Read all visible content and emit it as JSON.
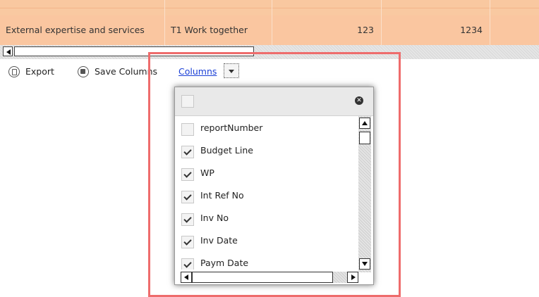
{
  "table": {
    "row": {
      "cost_category": "External expertise and services",
      "work_package": "T1 Work together",
      "value_1": "123",
      "value_2": "1234"
    },
    "row_color": "#fac6a0"
  },
  "toolbar": {
    "export_label": "Export",
    "save_columns_label": "Save Columns",
    "columns_label": "Columns"
  },
  "columns_popup": {
    "items": [
      {
        "label": "reportNumber",
        "checked": false
      },
      {
        "label": "Budget Line",
        "checked": true
      },
      {
        "label": "WP",
        "checked": true
      },
      {
        "label": "Int Ref No",
        "checked": true
      },
      {
        "label": "Inv No",
        "checked": true
      },
      {
        "label": "Inv Date",
        "checked": true
      },
      {
        "label": "Paym Date",
        "checked": true
      }
    ]
  },
  "highlight_color": "#ee6c6c"
}
